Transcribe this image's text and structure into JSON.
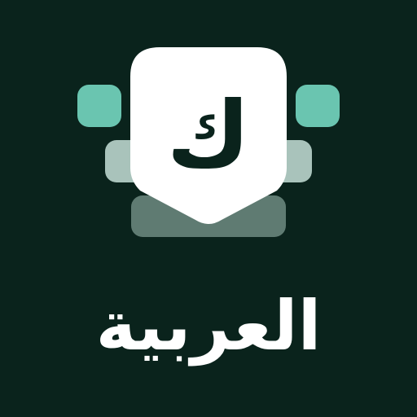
{
  "logo": {
    "key_letter": "ك",
    "colors": {
      "background": "#0a231c",
      "accent_key": "#6ac5b0",
      "mid_key": "#a9c3bb",
      "space_bar": "#5f7b72",
      "popup": "#ffffff"
    }
  },
  "app_name": "العربية"
}
